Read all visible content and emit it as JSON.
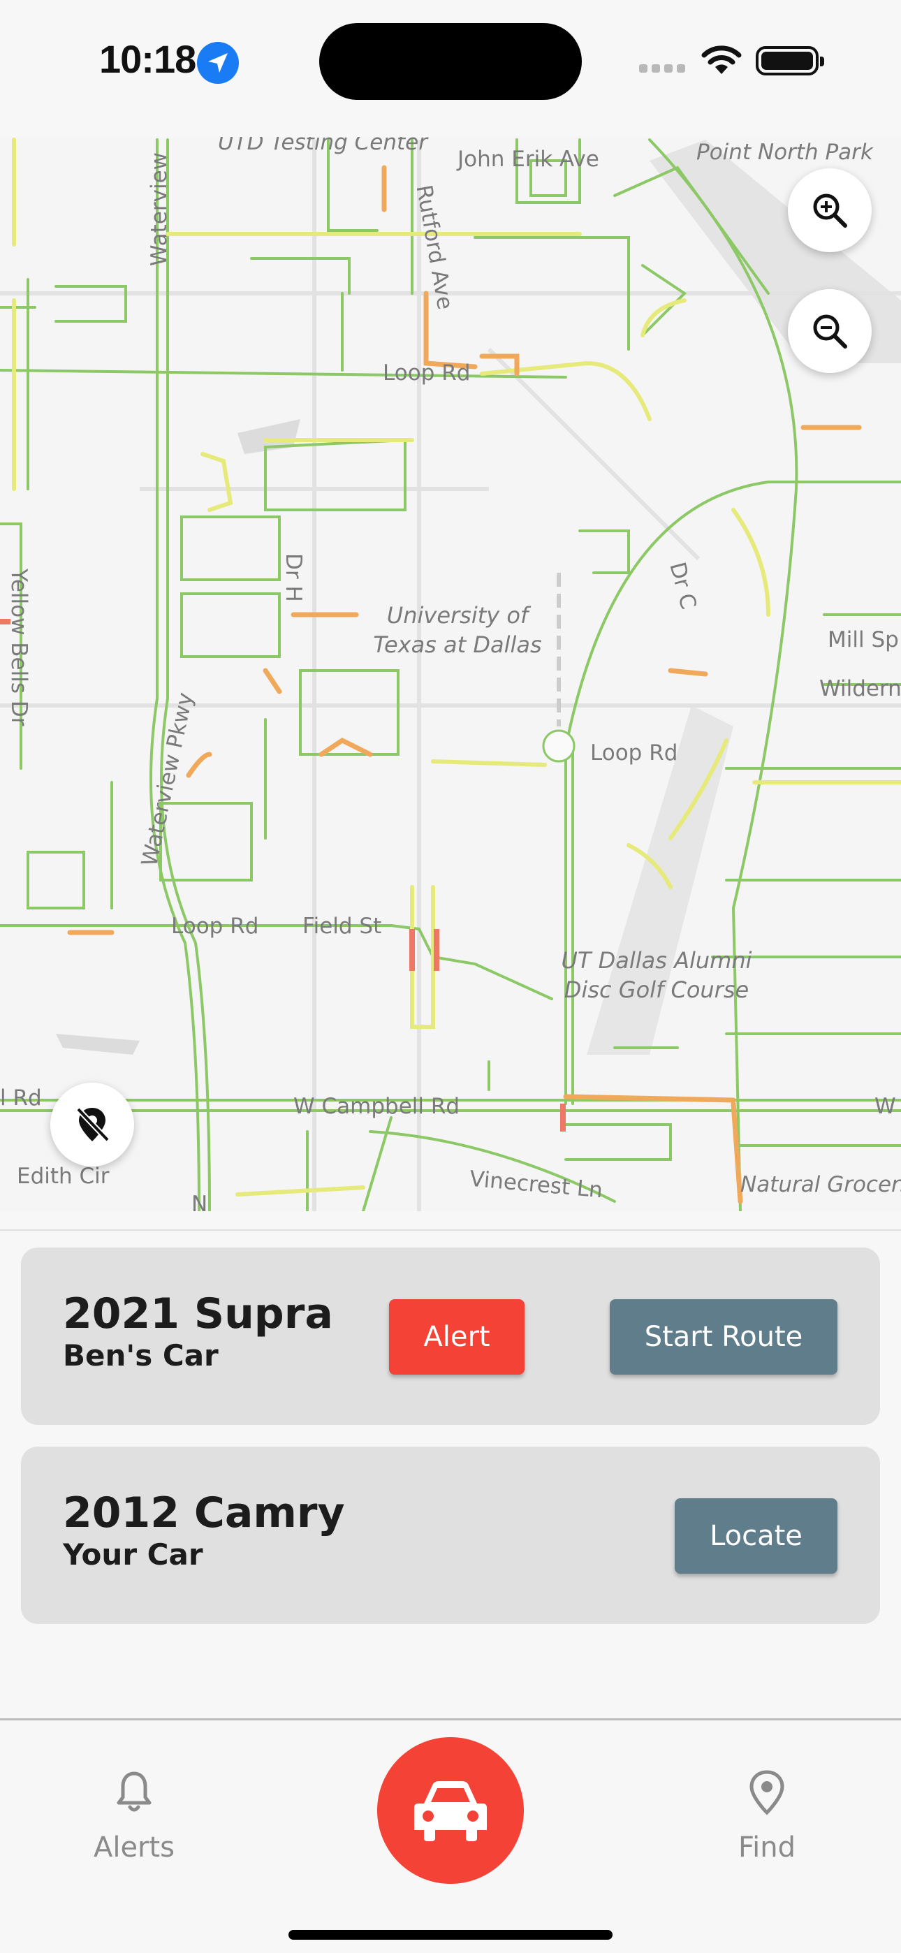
{
  "status_bar": {
    "time": "10:18"
  },
  "map": {
    "labels": {
      "utd_testing_center": "UTD Testing Center",
      "john_erik_ave": "John Erik Ave",
      "point_north_park": "Point North Park",
      "waterview": "Waterview",
      "rutford_ave": "Rutford Ave",
      "loop_rd_1": "Loop Rd",
      "loop_rd_2": "Loop Rd",
      "loop_rd_3": "Loop Rd",
      "dr_c": "Dr C",
      "dr_h": "Dr H",
      "university_line1": "University of",
      "university_line2": "Texas at Dallas",
      "yellow_bells_dr": "Yellow Bells Dr",
      "waterview_pkwy": "Waterview Pkwy",
      "mill_sp": "Mill Sp",
      "wildern": "Wildern",
      "field_st": "Field St",
      "disc_golf_line1": "UT Dallas Alumni",
      "disc_golf_line2": "Disc Golf Course",
      "w_campbell_rd": "W Campbell Rd",
      "rd_left": "l Rd",
      "w_right": "W",
      "edith_cir": "Edith Cir",
      "vinecrest_ln": "Vinecrest Ln",
      "natural_grocers": "Natural Grocers",
      "n_marker": "N"
    },
    "controls": {
      "zoom_in_icon": "zoom-in-icon",
      "zoom_out_icon": "zoom-out-icon",
      "location_off_icon": "location-off-icon"
    }
  },
  "cars": [
    {
      "model": "2021 Supra",
      "owner": "Ben's Car",
      "alert_label": "Alert",
      "route_label": "Start Route"
    },
    {
      "model": "2012 Camry",
      "owner": "Your Car",
      "locate_label": "Locate"
    }
  ],
  "bottom_nav": {
    "alerts_label": "Alerts",
    "find_label": "Find",
    "center_icon": "car-icon"
  },
  "colors": {
    "accent_red": "#f44336",
    "button_slate": "#607d8b",
    "card_bg": "#e0e0e0"
  }
}
